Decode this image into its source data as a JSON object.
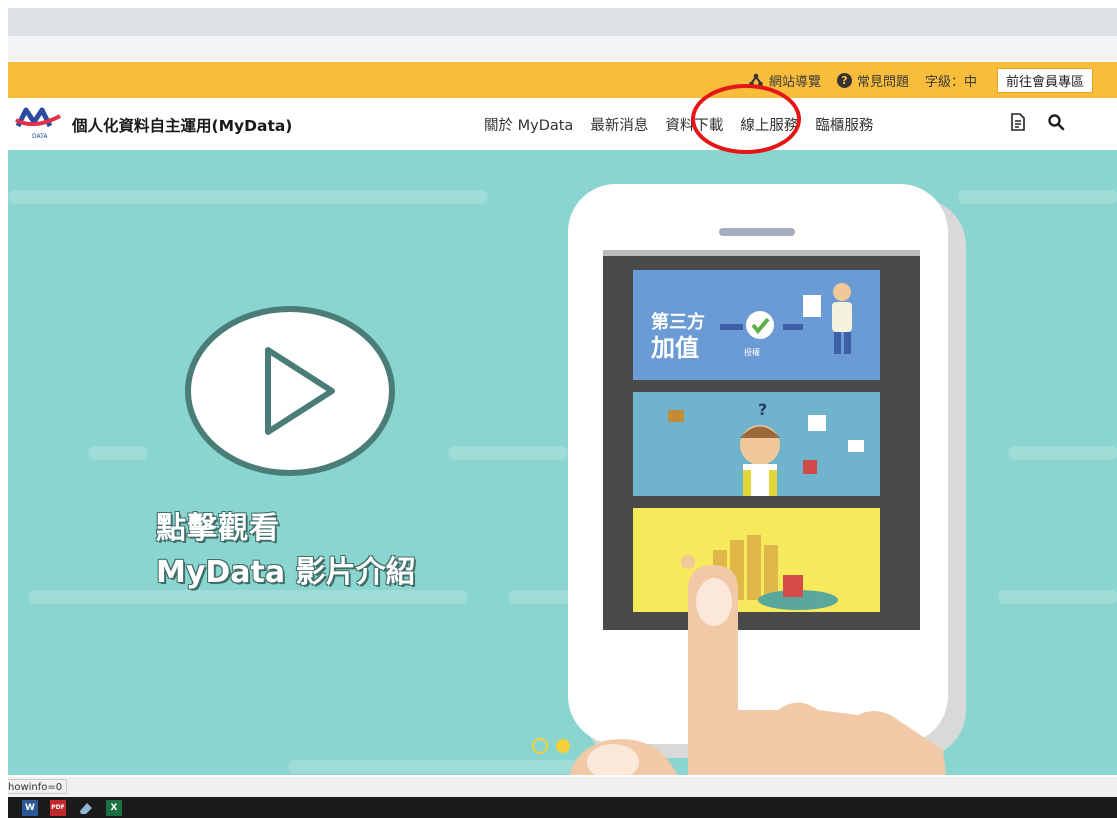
{
  "utility_bar": {
    "sitemap_label": "網站導覽",
    "faq_label": "常見問題",
    "font_size_label": "字級：中",
    "member_button_label": "前往會員專區"
  },
  "header": {
    "site_title": "個人化資料自主運用(MyData)",
    "logo_text": "DATA",
    "nav_items": [
      "關於 MyData",
      "最新消息",
      "資料下載",
      "線上服務",
      "臨櫃服務"
    ],
    "tool_icons": [
      "document-icon",
      "search-icon"
    ]
  },
  "hero": {
    "caption_line1": "點擊觀看",
    "caption_line2": "MyData 影片介紹",
    "panel1_text": "第三方",
    "panel1_text2": "加值",
    "panel1_small": "授權",
    "background_color": "#8ad5cf"
  },
  "annotation": {
    "highlight_color": "#e51616",
    "highlighted_item": "資料下載"
  },
  "status_bar": {
    "url_fragment": "howinfo=0"
  },
  "taskbar": {
    "apps": [
      "word-icon",
      "pdf-icon",
      "eraser-icon",
      "excel-icon"
    ],
    "word_glyph": "W",
    "pdf_glyph": "PDF",
    "excel_glyph": "X"
  },
  "colors": {
    "accent_yellow": "#f8bd3a",
    "hero_teal": "#8ad5cf",
    "logo_blue": "#2b4aa0",
    "logo_red": "#e0324b"
  }
}
